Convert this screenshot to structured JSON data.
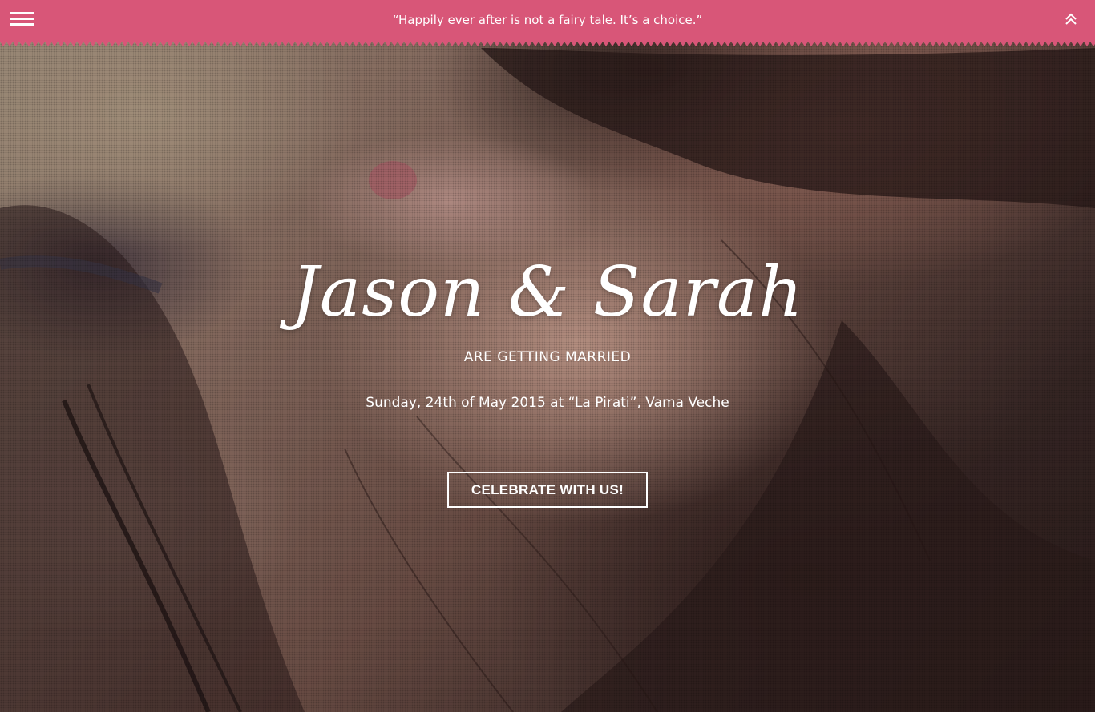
{
  "topbar": {
    "quote": "“Happily ever after is not a fairy tale. It’s a choice.”",
    "menu_icon": "hamburger-menu-icon",
    "scroll_top_icon": "double-chevron-up-icon",
    "background_color": "#d85678"
  },
  "hero": {
    "names": "Jason & Sarah",
    "subtitle": "ARE GETTING MARRIED",
    "event_details": "Sunday, 24th of May 2015 at “La Pirati”, Vama Veche",
    "cta_label": "CELEBRATE WITH US!"
  }
}
